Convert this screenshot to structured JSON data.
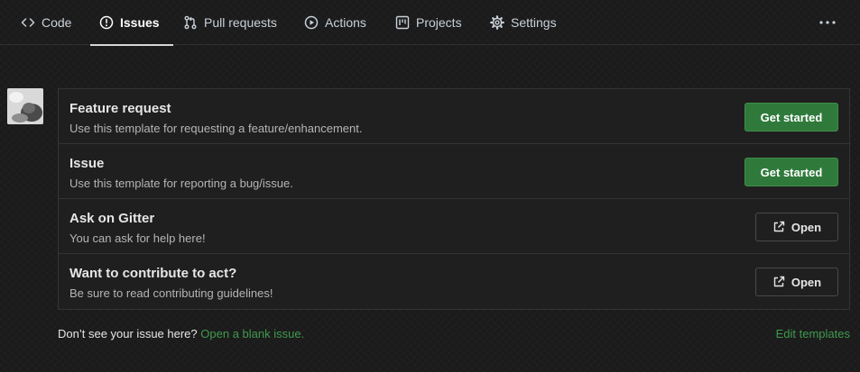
{
  "nav": {
    "tabs": [
      {
        "label": "Code",
        "icon": "code-icon"
      },
      {
        "label": "Issues",
        "icon": "issue-opened-icon",
        "active": true
      },
      {
        "label": "Pull requests",
        "icon": "pull-request-icon"
      },
      {
        "label": "Actions",
        "icon": "play-icon"
      },
      {
        "label": "Projects",
        "icon": "project-icon"
      },
      {
        "label": "Settings",
        "icon": "gear-icon"
      }
    ],
    "more_icon": "kebab-horizontal-icon"
  },
  "templates": [
    {
      "title": "Feature request",
      "description": "Use this template for requesting a feature/enhancement.",
      "button": "Get started",
      "kind": "primary"
    },
    {
      "title": "Issue",
      "description": "Use this template for reporting a bug/issue.",
      "button": "Get started",
      "kind": "primary"
    },
    {
      "title": "Ask on Gitter",
      "description": "You can ask for help here!",
      "button": "Open",
      "kind": "external"
    },
    {
      "title": "Want to contribute to act?",
      "description": "Be sure to read contributing guidelines!",
      "button": "Open",
      "kind": "external"
    }
  ],
  "footer": {
    "prompt": "Don’t see your issue here?",
    "blank_issue_link": "Open a blank issue.",
    "edit_templates_link": "Edit templates"
  },
  "colors": {
    "accent_green": "#2f7a3b",
    "link_green": "#3f9a4d",
    "background": "#1b1b1b"
  }
}
